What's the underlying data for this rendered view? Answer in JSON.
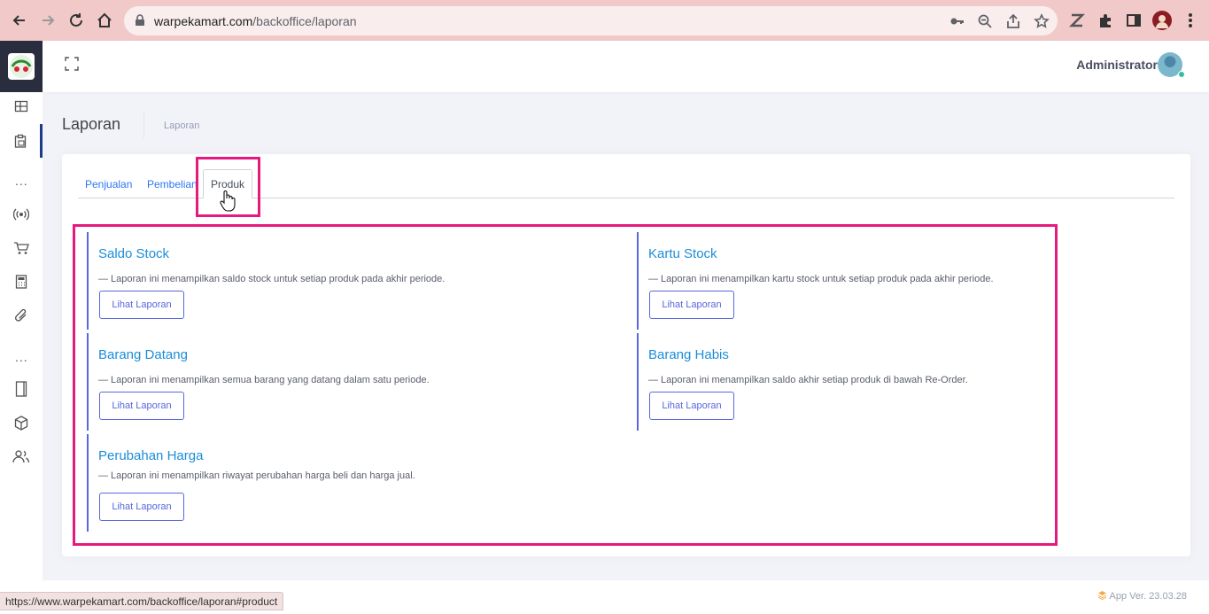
{
  "browser": {
    "url_host": "warpekamart.com",
    "url_path": "/backoffice/laporan",
    "status_url": "https://www.warpekamart.com/backoffice/laporan#product"
  },
  "sidebar": {
    "items": [
      {
        "icon": "dashboard-icon"
      },
      {
        "icon": "clipboard-icon",
        "active": true
      },
      {
        "icon": "broadcast-icon"
      },
      {
        "icon": "cart-icon"
      },
      {
        "icon": "calculator-icon"
      },
      {
        "icon": "paperclip-icon"
      },
      {
        "icon": "notebook-icon"
      },
      {
        "icon": "box-icon"
      },
      {
        "icon": "users-icon"
      }
    ],
    "dots": "..."
  },
  "header": {
    "user_name": "Administrator"
  },
  "page": {
    "title": "Laporan",
    "breadcrumb": "Laporan"
  },
  "tabs": [
    {
      "label": "Penjualan"
    },
    {
      "label": "Pembelian"
    },
    {
      "label": "Produk",
      "active": true
    }
  ],
  "reports": [
    {
      "title": "Saldo Stock",
      "desc": "— Laporan ini menampilkan saldo stock untuk setiap produk pada akhir periode.",
      "button": "Lihat Laporan"
    },
    {
      "title": "Kartu Stock",
      "desc": "— Laporan ini menampilkan kartu stock untuk setiap produk pada akhir periode.",
      "button": "Lihat Laporan"
    },
    {
      "title": "Barang Datang",
      "desc": "— Laporan ini menampilkan semua barang yang datang dalam satu periode.",
      "button": "Lihat Laporan"
    },
    {
      "title": "Barang Habis",
      "desc": "— Laporan ini menampilkan saldo akhir setiap produk di bawah Re-Order.",
      "button": "Lihat Laporan"
    },
    {
      "title": "Perubahan Harga",
      "desc": "— Laporan ini menampilkan riwayat perubahan harga beli dan harga jual.",
      "button": "Lihat Laporan"
    }
  ],
  "footer": {
    "app_version": "App Ver. 23.03.28"
  },
  "colors": {
    "highlight": "#e6197f",
    "accent": "#5867dd",
    "link": "#1c8dd8"
  }
}
